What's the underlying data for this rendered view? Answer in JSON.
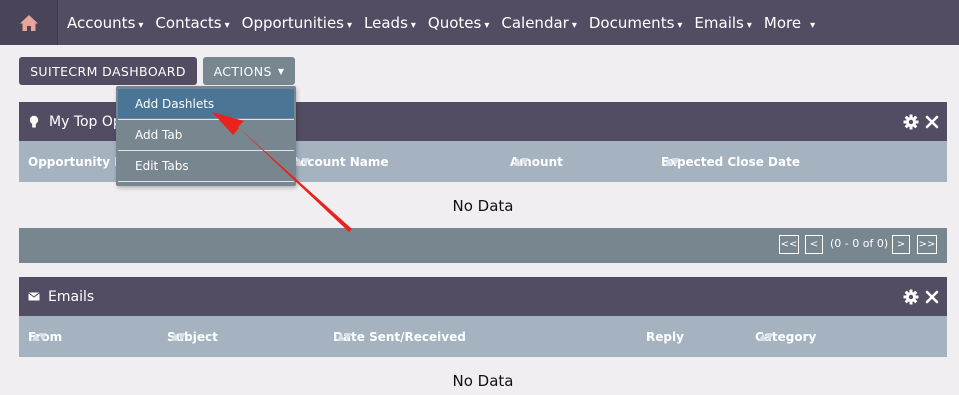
{
  "nav": {
    "items": [
      {
        "label": "Accounts"
      },
      {
        "label": "Contacts"
      },
      {
        "label": "Opportunities"
      },
      {
        "label": "Leads"
      },
      {
        "label": "Quotes"
      },
      {
        "label": "Calendar"
      },
      {
        "label": "Documents"
      },
      {
        "label": "Emails"
      },
      {
        "label": "More"
      }
    ]
  },
  "toolbar": {
    "dashboard_label": "SUITECRM DASHBOARD",
    "actions_label": "ACTIONS"
  },
  "actions_menu": {
    "items": [
      {
        "label": "Add Dashlets"
      },
      {
        "label": "Add Tab"
      },
      {
        "label": "Edit Tabs"
      }
    ]
  },
  "opportunities_dashlet": {
    "title": "My Top Ope",
    "columns": [
      "Opportunity Nam",
      "Account Name",
      "Amount",
      "Expected Close Date"
    ],
    "empty_text": "No Data",
    "pager": {
      "first": "<<",
      "prev": "<",
      "status": "(0 - 0 of 0)",
      "next": ">",
      "last": ">>"
    }
  },
  "emails_dashlet": {
    "title": "Emails",
    "columns": [
      "From",
      "Subject",
      "Date Sent/Received",
      "Reply",
      "Category"
    ],
    "empty_text": "No Data"
  },
  "colors": {
    "nav_bg": "#534d64",
    "header_bg": "#534d64",
    "column_bg": "#a5b3c1",
    "actions_bg": "#77868f",
    "menu_active": "#4a7597",
    "annotation_arrow": "#e8221c"
  }
}
